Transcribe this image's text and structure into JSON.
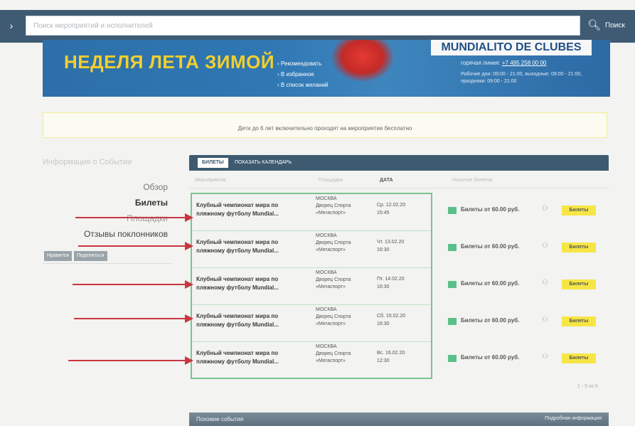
{
  "search": {
    "placeholder": "Поиск мероприятий и исполнителей",
    "button_label": "Поиск"
  },
  "banner": {
    "promo_title": "НЕДЕЛЯ ЛЕТА ЗИМОЙ",
    "links": [
      "Рекомендовать",
      "В избранное",
      "В список желаний"
    ],
    "event_name": "MUNDIALITO DE CLUBES",
    "hotline_label": "горячая линия:",
    "hotline_phone": "+7 495 258 00 00",
    "hours": "Рабочие дни: 09:00 - 21:00, выходные: 09:00 - 21:00, праздники: 09:00 - 21:00"
  },
  "notice": "Дети до 6 лет включительно проходят на мероприятие бесплатно",
  "sidebar": {
    "title": "Информация о Событии",
    "items": [
      {
        "label": "Обзор"
      },
      {
        "label": "Билеты"
      },
      {
        "label": "Площадки"
      },
      {
        "label": "Отзывы поклонников"
      }
    ],
    "like_label": "Нравится",
    "share_label": "Поделиться"
  },
  "tabs": {
    "active": "БИЛЕТЫ",
    "calendar": "ПОКАЗАТЬ КАЛЕНДАРЬ"
  },
  "table": {
    "headers": {
      "event": "Мероприятие",
      "place": "Площадка",
      "date": "ДАТА",
      "tickets": "Наличие билетов"
    },
    "rows": [
      {
        "title": "Клубный чемпионат мира по пляжному футболу Mundial...",
        "city": "МОСКВА",
        "venue": "Дворец Спорта «Мегаспорт»",
        "date": "Ср. 12.02.20",
        "time": "15:45",
        "price": "Билеты от 60.00 руб.",
        "buy": "Билеты"
      },
      {
        "title": "Клубный чемпионат мира по пляжному футболу Mundial...",
        "city": "МОСКВА",
        "venue": "Дворец Спорта «Мегаспорт»",
        "date": "Чт. 13.02.20",
        "time": "16:30",
        "price": "Билеты от 60.00 руб.",
        "buy": "Билеты"
      },
      {
        "title": "Клубный чемпионат мира по пляжному футболу Mundial...",
        "city": "МОСКВА",
        "venue": "Дворец Спорта «Мегаспорт»",
        "date": "Пт. 14.02.20",
        "time": "16:30",
        "price": "Билеты от 60.00 руб.",
        "buy": "Билеты"
      },
      {
        "title": "Клубный чемпионат мира по пляжному футболу Mundial...",
        "city": "МОСКВА",
        "venue": "Дворец Спорта «Мегаспорт»",
        "date": "Сб. 15.02.20",
        "time": "16:30",
        "price": "Билеты от 60.00 руб.",
        "buy": "Билеты"
      },
      {
        "title": "Клубный чемпионат мира по пляжному футболу Mundial...",
        "city": "МОСКВА",
        "venue": "Дворец Спорта «Мегаспорт»",
        "date": "Вс. 16.02.20",
        "time": "12:30",
        "price": "Билеты от 60.00 руб.",
        "buy": "Билеты"
      }
    ],
    "pager": "1 - 5 из 5"
  },
  "bottom": {
    "title": "Похожие события",
    "info": "Подробная информация"
  },
  "colors": {
    "header_bg": "#3f5b74",
    "accent_green": "#79c48f",
    "button_yellow": "#f6e645",
    "arrow_red": "#c8373f"
  }
}
